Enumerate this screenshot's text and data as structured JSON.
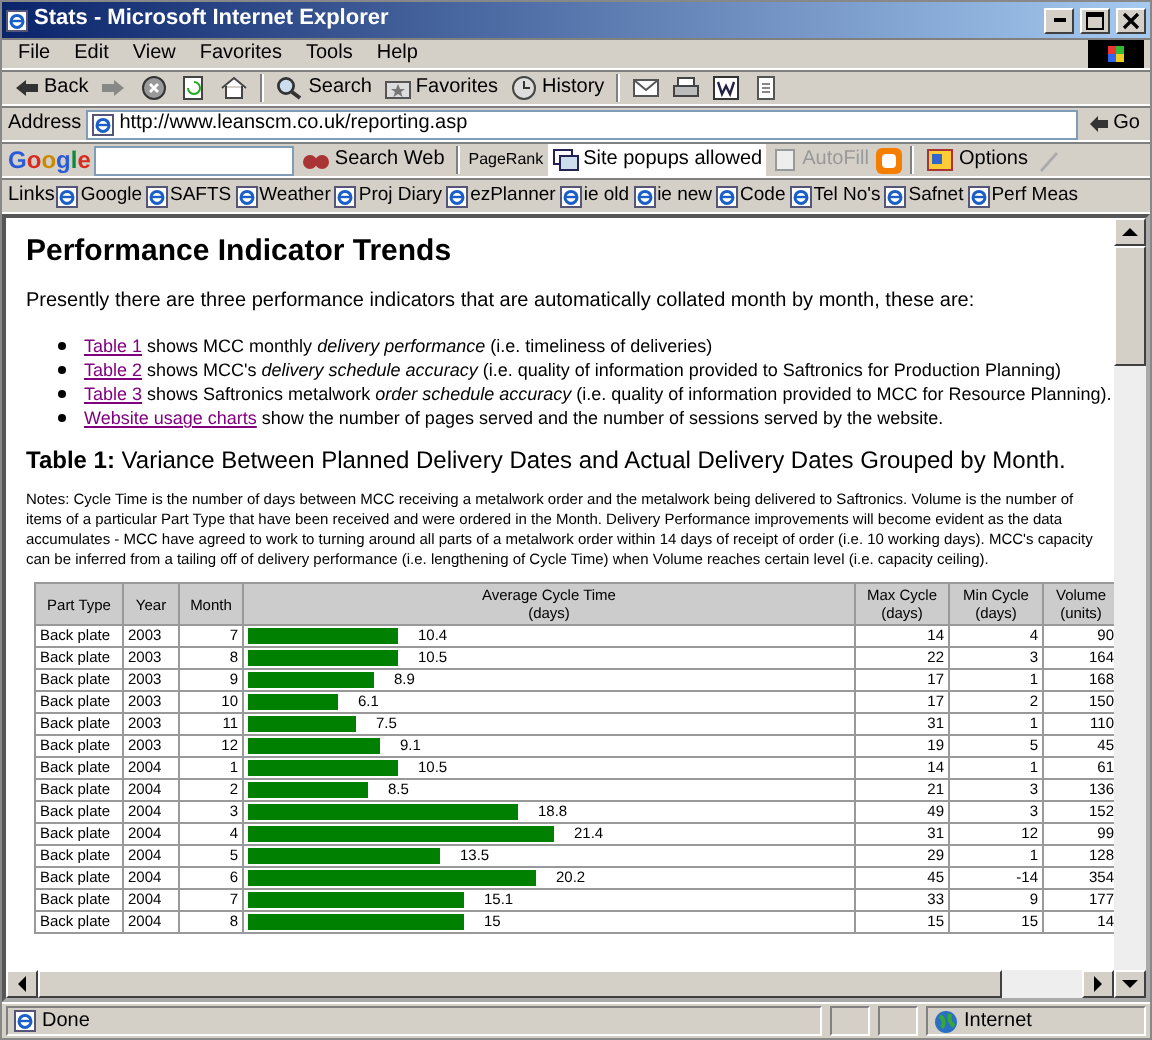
{
  "window": {
    "title": "Stats - Microsoft Internet Explorer"
  },
  "menu": [
    {
      "label": "File"
    },
    {
      "label": "Edit"
    },
    {
      "label": "View"
    },
    {
      "label": "Favorites"
    },
    {
      "label": "Tools"
    },
    {
      "label": "Help"
    }
  ],
  "toolbar": [
    {
      "kind": "back",
      "label": "Back"
    },
    {
      "kind": "forward"
    },
    {
      "kind": "stop"
    },
    {
      "kind": "refresh"
    },
    {
      "kind": "home"
    },
    {
      "kind": "search",
      "label": "Search"
    },
    {
      "kind": "favorites",
      "label": "Favorites"
    },
    {
      "kind": "history",
      "label": "History"
    },
    {
      "kind": "mail"
    },
    {
      "kind": "print"
    },
    {
      "kind": "edit"
    },
    {
      "kind": "discuss"
    }
  ],
  "address": {
    "label": "Address",
    "value": "http://www.leanscm.co.uk/reporting.asp",
    "go": "Go"
  },
  "google_bar": {
    "logo": "Google",
    "search_button": "Search Web",
    "pagerank": "PageRank",
    "popups": "Site popups allowed",
    "autofill": {
      "label": "AutoFill",
      "disabled": true
    },
    "options": "Options"
  },
  "links": {
    "label": "Links",
    "items": [
      {
        "label": "Google"
      },
      {
        "label": "SAFTS"
      },
      {
        "label": "Weather"
      },
      {
        "label": "Proj Diary"
      },
      {
        "label": "ezPlanner"
      },
      {
        "label": "ie old"
      },
      {
        "label": "ie new"
      },
      {
        "label": "Code"
      },
      {
        "label": "Tel No's"
      },
      {
        "label": "Safnet"
      },
      {
        "label": "Perf Meas"
      }
    ]
  },
  "page": {
    "heading": "Performance Indicator Trends",
    "intro": "Presently there are three performance indicators that are automatically collated month by month, these are:",
    "bullets": [
      {
        "link": "Table 1",
        "text": "shows MCC monthly *delivery performance* (i.e. timeliness of deliveries)"
      },
      {
        "link": "Table 2",
        "text": "shows MCC's *delivery schedule accuracy* (i.e. quality of information provided to Saftronics for Production Planning)"
      },
      {
        "link": "Table 3",
        "text": "shows Saftronics metalwork *order schedule accuracy* (i.e. quality of information provided to MCC for Resource Planning)."
      },
      {
        "link": "Website usage charts",
        "text": "show the number of pages served and the number of sessions served by the website."
      }
    ],
    "caption": {
      "label": "Table 1:",
      "text": "Variance Between Planned Delivery Dates and Actual Delivery Dates Grouped by Month."
    },
    "notes": "Notes: Cycle Time is the number of days between MCC receiving a metalwork order and the metalwork being delivered to Saftronics. Volume is the number of items of a particular Part Type that have been received and were ordered in the Month. Delivery Performance improvements will become evident as the data accumulates - MCC have agreed to work to turning around all parts of a metalwork order within 14 days of receipt of order (i.e. 10 working days). MCC's capacity can be inferred from a tailing off of delivery performance (i.e. lengthening of Cycle Time) when Volume reaches certain level (i.e. capacity ceiling).",
    "table": {
      "columns": [
        {
          "label": "Part Type"
        },
        {
          "label": "Year"
        },
        {
          "label": "Month"
        },
        {
          "label": "Average Cycle Time",
          "unit": "(days)"
        },
        {
          "label": "Max Cycle",
          "unit": "(days)"
        },
        {
          "label": "Min Cycle",
          "unit": "(days)"
        },
        {
          "label": "Volume",
          "unit": "(units)"
        }
      ],
      "rows": [
        {
          "part_type": "Back plate",
          "year": "2003",
          "month": "7",
          "average": "10.4",
          "level": 0.25,
          "max": "14",
          "min": "4",
          "volume": "90"
        },
        {
          "part_type": "Back plate",
          "year": "2003",
          "month": "8",
          "average": "10.5",
          "level": 0.25,
          "max": "22",
          "min": "3",
          "volume": "164"
        },
        {
          "part_type": "Back plate",
          "year": "2003",
          "month": "9",
          "average": "8.9",
          "level": 0.21,
          "max": "17",
          "min": "1",
          "volume": "168"
        },
        {
          "part_type": "Back plate",
          "year": "2003",
          "month": "10",
          "average": "6.1",
          "level": 0.15,
          "max": "17",
          "min": "2",
          "volume": "150"
        },
        {
          "part_type": "Back plate",
          "year": "2003",
          "month": "11",
          "average": "7.5",
          "level": 0.18,
          "max": "31",
          "min": "1",
          "volume": "110"
        },
        {
          "part_type": "Back plate",
          "year": "2003",
          "month": "12",
          "average": "9.1",
          "level": 0.22,
          "max": "19",
          "min": "5",
          "volume": "45"
        },
        {
          "part_type": "Back plate",
          "year": "2004",
          "month": "1",
          "average": "10.5",
          "level": 0.25,
          "max": "14",
          "min": "1",
          "volume": "61"
        },
        {
          "part_type": "Back plate",
          "year": "2004",
          "month": "2",
          "average": "8.5",
          "level": 0.2,
          "max": "21",
          "min": "3",
          "volume": "136"
        },
        {
          "part_type": "Back plate",
          "year": "2004",
          "month": "3",
          "average": "18.8",
          "level": 0.45,
          "max": "49",
          "min": "3",
          "volume": "152"
        },
        {
          "part_type": "Back plate",
          "year": "2004",
          "month": "4",
          "average": "21.4",
          "level": 0.51,
          "max": "31",
          "min": "12",
          "volume": "99"
        },
        {
          "part_type": "Back plate",
          "year": "2004",
          "month": "5",
          "average": "13.5",
          "level": 0.32,
          "max": "29",
          "min": "1",
          "volume": "128"
        },
        {
          "part_type": "Back plate",
          "year": "2004",
          "month": "6",
          "average": "20.2",
          "level": 0.48,
          "max": "45",
          "min": "-14",
          "volume": "354"
        },
        {
          "part_type": "Back plate",
          "year": "2004",
          "month": "7",
          "average": "15.1",
          "level": 0.36,
          "max": "33",
          "min": "9",
          "volume": "177"
        },
        {
          "part_type": "Back plate",
          "year": "2004",
          "month": "8",
          "average": "15",
          "level": 0.36,
          "max": "15",
          "min": "15",
          "volume": "14"
        }
      ]
    }
  },
  "status_bar": {
    "text": "Done",
    "zone": "Internet"
  }
}
